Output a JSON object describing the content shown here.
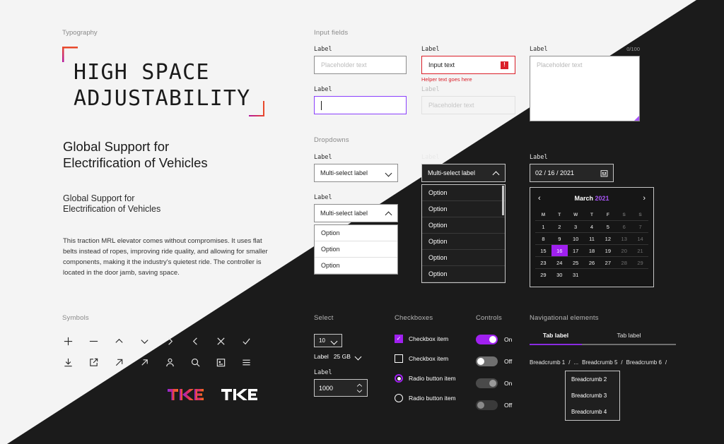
{
  "theme": {
    "accent_purple": "#a020f0",
    "focus_purple": "#8a3ffc",
    "error_red": "#da1e28",
    "bracket_red": "#e8492b",
    "bracket_magenta": "#b5179e",
    "light_bg": "#f4f4f4",
    "dark_bg": "#1b1b1b"
  },
  "typography": {
    "section_label": "Typography",
    "display_line1": "HIGH SPACE",
    "display_line2": "ADJUSTABILITY",
    "heading_line1": "Global Support for",
    "heading_line2": "Electrification of Vehicles",
    "subheading_line1": "Global Support for",
    "subheading_line2": "Electrification of Vehicles",
    "body": "This traction MRL elevator comes without compromises. It uses flat belts instead of ropes, improving ride quality, and allowing for smaller components, making it the industry's quietest ride. The controller is located in the door jamb, saving space."
  },
  "input_fields": {
    "section_label": "Input fields",
    "default": {
      "label": "Label",
      "placeholder": "Placeholder text",
      "value": ""
    },
    "error": {
      "label": "Label",
      "value": "Input text",
      "helper": "Helper text goes here",
      "icon": "alert-icon"
    },
    "textarea": {
      "label": "Label",
      "placeholder": "Placeholder text",
      "counter": "0/100"
    },
    "focused": {
      "label": "Label",
      "value": ""
    },
    "disabled": {
      "label": "Label",
      "placeholder": "Placeholder text"
    }
  },
  "dropdowns": {
    "section_label": "Dropdowns",
    "closed": {
      "label": "Label",
      "value": "Multi-select label"
    },
    "open_light": {
      "label": "Label",
      "value": "Multi-select label",
      "options": [
        "Option",
        "Option",
        "Option"
      ]
    },
    "open_dark": {
      "label": "Label",
      "value": "Multi-select label",
      "options": [
        "Option",
        "Option",
        "Option",
        "Option",
        "Option",
        "Option"
      ]
    }
  },
  "datepicker": {
    "label": "Label",
    "value": "02 / 16 / 2021",
    "icon": "calendar-icon",
    "month": "March",
    "year": "2021",
    "prev_icon": "chevron-left-icon",
    "next_icon": "chevron-right-icon",
    "dow": [
      "M",
      "T",
      "W",
      "T",
      "F",
      "S",
      "S"
    ],
    "weeks": [
      [
        "1",
        "2",
        "3",
        "4",
        "5",
        "6",
        "7"
      ],
      [
        "8",
        "9",
        "10",
        "11",
        "12",
        "13",
        "14"
      ],
      [
        "15",
        "16",
        "17",
        "18",
        "19",
        "20",
        "21"
      ],
      [
        "23",
        "24",
        "25",
        "26",
        "27",
        "28",
        "29"
      ],
      [
        "29",
        "30",
        "31",
        "",
        "",
        "",
        ""
      ]
    ],
    "selected_day": "16"
  },
  "symbols": {
    "section_label": "Symbols",
    "row1": [
      "plus-icon",
      "minus-icon",
      "chevron-up-icon",
      "chevron-down-icon",
      "chevron-right-icon",
      "chevron-left-icon",
      "close-icon",
      "check-icon"
    ],
    "row2": [
      "download-icon",
      "external-link-icon",
      "arrow-up-right-icon",
      "arrow-up-right-small-icon",
      "person-icon",
      "search-icon",
      "calendar-icon",
      "menu-icon"
    ],
    "logo_gradient": "TKE",
    "logo_mono": "TKE"
  },
  "select": {
    "section_label": "Select",
    "page_size": "10",
    "inline_label": "Label",
    "inline_value": "25 GB",
    "number_label": "Label",
    "number_value": "1000"
  },
  "checkboxes": {
    "section_label": "Checkboxes",
    "items": [
      {
        "label": "Checkbox item",
        "type": "checkbox",
        "checked": true
      },
      {
        "label": "Checkbox item",
        "type": "checkbox",
        "checked": false
      },
      {
        "label": "Radio button item",
        "type": "radio",
        "checked": true
      },
      {
        "label": "Radio button item",
        "type": "radio",
        "checked": false
      }
    ]
  },
  "controls": {
    "section_label": "Controls",
    "toggles": [
      {
        "label": "On",
        "state": "on"
      },
      {
        "label": "Off",
        "state": "off"
      },
      {
        "label": "On",
        "state": "dis-on"
      },
      {
        "label": "Off",
        "state": "dis-off"
      }
    ]
  },
  "navigation": {
    "section_label": "Navigational elements",
    "tabs": [
      {
        "label": "Tab label",
        "active": true
      },
      {
        "label": "Tab label",
        "active": false
      }
    ],
    "breadcrumbs": [
      "Breadcrumb 1",
      "...",
      "Breadcrumb 5",
      "Breadcrumb 6"
    ],
    "separator": "/",
    "overflow_menu": [
      "Breadcrumb 2",
      "Breadcrumb 3",
      "Breadcrumb 4"
    ]
  }
}
